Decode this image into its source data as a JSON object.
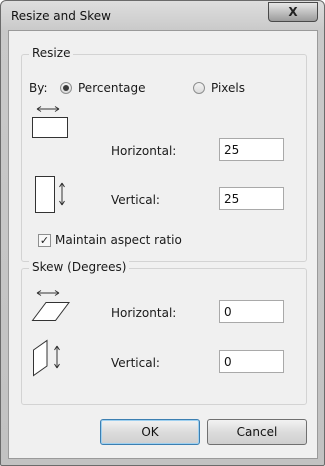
{
  "window": {
    "title": "Resize and Skew",
    "close_symbol": "X"
  },
  "resize": {
    "legend": "Resize",
    "by_label": "By:",
    "options": {
      "percentage": "Percentage",
      "pixels": "Pixels"
    },
    "selected": "percentage",
    "horizontal_label": "Horizontal:",
    "horizontal_value": "25",
    "vertical_label": "Vertical:",
    "vertical_value": "25",
    "maintain_aspect_label": "Maintain aspect ratio",
    "maintain_aspect_checked": true
  },
  "skew": {
    "legend": "Skew (Degrees)",
    "horizontal_label": "Horizontal:",
    "horizontal_value": "0",
    "vertical_label": "Vertical:",
    "vertical_value": "0"
  },
  "buttons": {
    "ok": "OK",
    "cancel": "Cancel"
  }
}
